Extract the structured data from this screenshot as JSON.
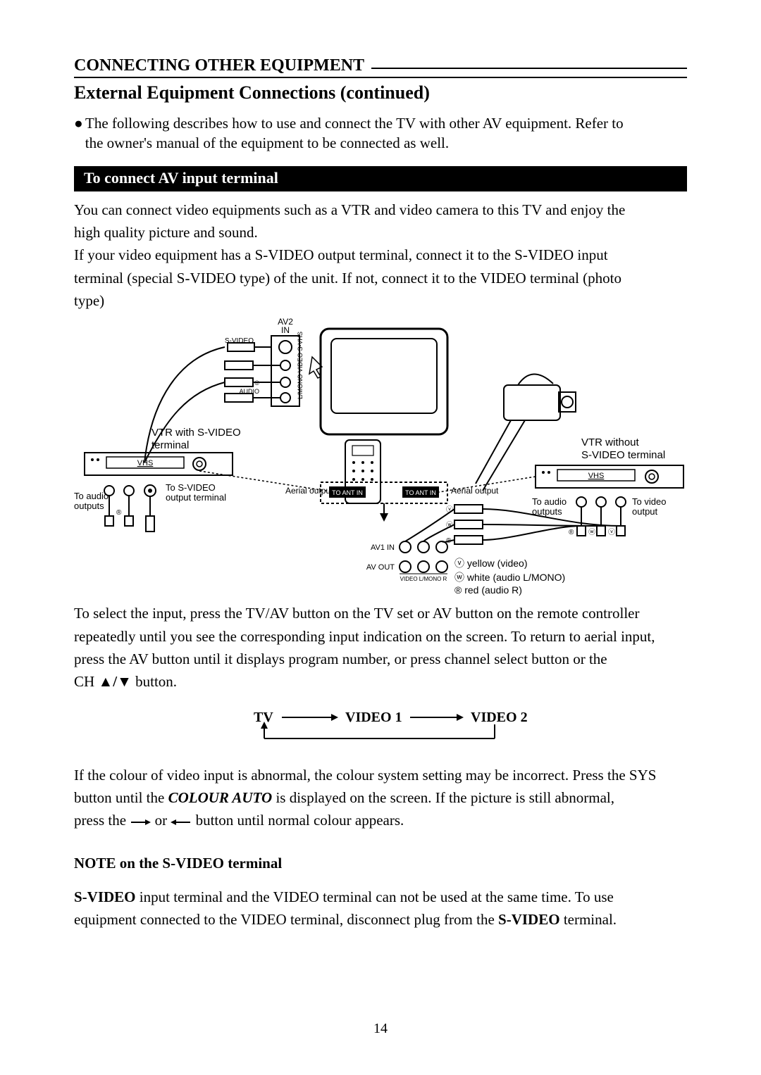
{
  "section_heading": "CONNECTING OTHER EQUIPMENT",
  "subsection_heading": "External Equipment Connections (continued)",
  "intro_line1": "The following describes how to use and connect the TV with other AV equipment. Refer to",
  "intro_line2": "the owner's manual of the equipment to be connected as well.",
  "black_bar": "To connect AV input terminal",
  "para1_l1": "You can connect video equipments such as a VTR and video camera to this TV and enjoy the",
  "para1_l2": "high quality picture and sound.",
  "para1_l3": "If your video equipment has a S-VIDEO output terminal, connect it to the S-VIDEO input",
  "para1_l4": "terminal (special S-VIDEO type) of the unit. If not, connect it to the VIDEO terminal (photo",
  "para1_l5": "type)",
  "diagram": {
    "av2_in": "AV2\nIN",
    "s_video": "S-VIDEO",
    "l_mono_video_svhs": "L/MONO VIDEO S-VHS",
    "r_audio": "AUDIO",
    "r_mark": "®",
    "vtr_with": "VTR with S-VIDEO\nterminal",
    "vtr_without": "VTR without\nS-VIDEO terminal",
    "vhs": "VHS",
    "to_svideo": "To S-VIDEO\noutput terminal",
    "to_audio_outputs": "To audio\noutputs",
    "to_video_output": "To video\noutput",
    "aerial_output": "Aerial output",
    "to_ant_in": "TO ANT IN",
    "av1_in": "AV1 IN",
    "av_out": "AV OUT",
    "video_lmono_r": "VIDEO L/MONO  R",
    "legend_video": "yellow  (video)",
    "legend_white": "white (audio L/MONO)",
    "legend_red": "red (audio R)",
    "circle_v": "ⓥ",
    "circle_w": "ⓦ",
    "circle_r": "®"
  },
  "para2_l1": "To select the input, press the TV/AV button on the TV set or AV button on the remote controller",
  "para2_l2": "repeatedly until you see the corresponding input indication on the screen. To return to aerial input,",
  "para2_l3": "press the AV button until it displays program number, or press channel select button or the",
  "para2_prefix": "CH ",
  "para2_suffix": " button.",
  "cycle_tv": "TV",
  "cycle_v1": "VIDEO 1",
  "cycle_v2": "VIDEO 2",
  "para3_l1": "If the colour of video input is abnormal, the colour system setting may be incorrect. Press the SYS",
  "para3_l2a": "button until the ",
  "para3_l2b": "COLOUR AUTO",
  "para3_l2c": " is displayed on the screen. If the picture is still abnormal,",
  "para3_l3a": "press the ",
  "para3_l3b": " or ",
  "para3_l3c": " button until normal colour appears.",
  "note_heading": "NOTE on the S-VIDEO terminal",
  "note_l1a": "S-VIDEO",
  "note_l1b": " input terminal and the VIDEO terminal can not be used at the same time. To use",
  "note_l2a": "equipment connected to the VIDEO terminal, disconnect plug from the ",
  "note_l2b": "S-VIDEO",
  "note_l2c": " terminal.",
  "page_number": "14"
}
